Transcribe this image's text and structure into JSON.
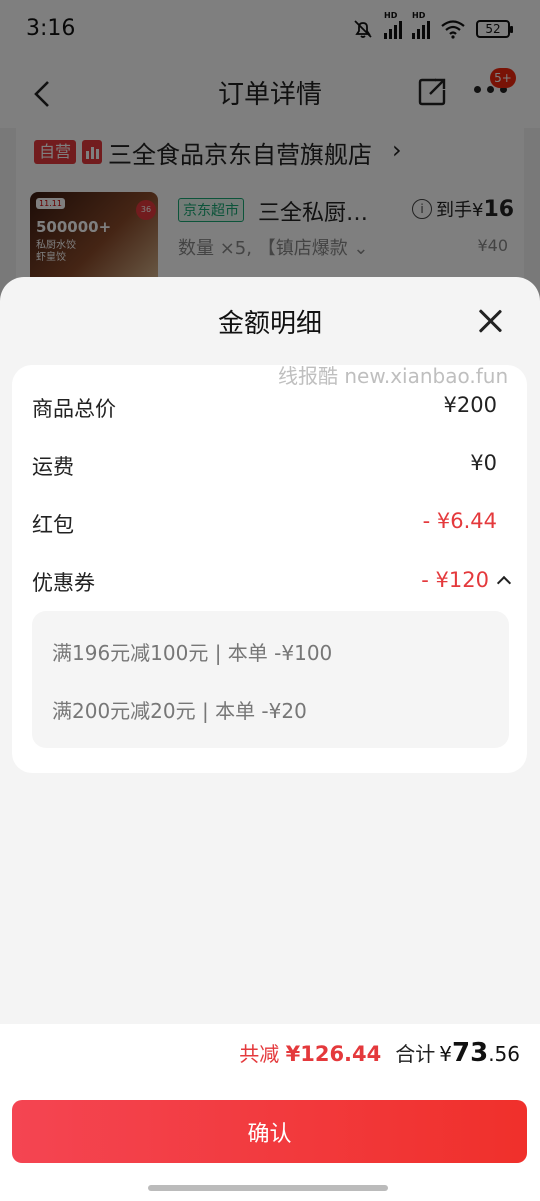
{
  "status_bar": {
    "time": "3:16",
    "hd1": "HD",
    "hd2": "HD",
    "battery": "52"
  },
  "nav": {
    "title": "订单详情",
    "badge": "5+"
  },
  "shop": {
    "self_tag": "自营",
    "name": "三全食品京东自营旗舰店",
    "arrow": "›"
  },
  "product": {
    "image_badge": "11.11",
    "image_big": "500000+",
    "image_sub": "私厨水饺 虾皇饺",
    "image_round": "36",
    "market_tag": "京东超市",
    "title": "三全私厨…",
    "arrive_label": "到手¥",
    "arrive_price": "16",
    "qty": "数量 ×5, 【镇店爆款 ⌄",
    "orig_price": "¥40"
  },
  "sheet": {
    "title": "金额明细",
    "rows": [
      {
        "label": "商品总价",
        "value": "¥200"
      },
      {
        "label": "运费",
        "value": "¥0"
      },
      {
        "label": "红包",
        "value": "- ¥6.44"
      },
      {
        "label": "优惠券",
        "value": "- ¥120"
      }
    ],
    "coupons": [
      "满196元减100元 | 本单 -¥100",
      "满200元减20元 | 本单 -¥20"
    ],
    "watermark": "线报酷 new.xianbao.fun"
  },
  "footer": {
    "saved_label": "共减",
    "saved_value": "¥126.44",
    "total_label": "合计",
    "total_currency": "¥",
    "total_int": "73",
    "total_dec": ".56",
    "confirm": "确认"
  },
  "colors": {
    "accent": "#e4393c",
    "market_green": "#19a974"
  }
}
